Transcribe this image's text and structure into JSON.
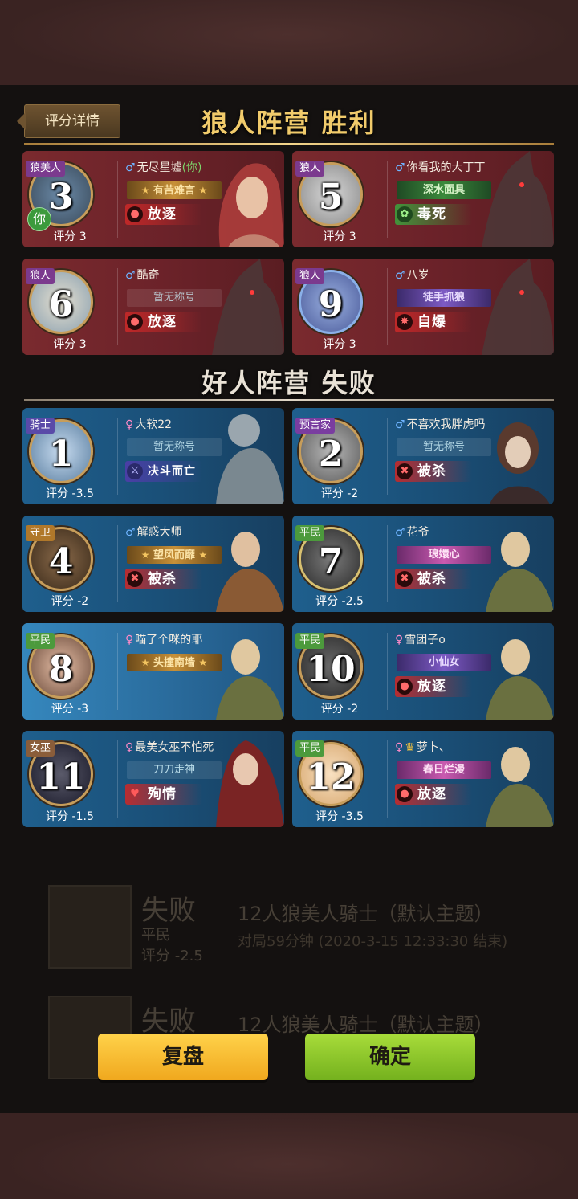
{
  "header": {
    "detail_button": "评分详情",
    "win_camp": "狼人阵营 胜利",
    "lose_camp": "好人阵营 失败"
  },
  "werewolf_cards": [
    {
      "seat": "3",
      "role": "狼美人",
      "gender": "♂",
      "name": "无尽星墟",
      "you_suffix": "(你)",
      "you_badge": "你",
      "title": "有苦难言",
      "outcome": "放逐",
      "score": "评分 3"
    },
    {
      "seat": "5",
      "role": "狼人",
      "gender": "♂",
      "name": "你看我的大丁丁",
      "title": "深水面具",
      "outcome": "毒死",
      "score": "评分 3"
    },
    {
      "seat": "6",
      "role": "狼人",
      "gender": "♂",
      "name": "酷奇",
      "title": "暂无称号",
      "outcome": "放逐",
      "score": "评分 3"
    },
    {
      "seat": "9",
      "role": "狼人",
      "gender": "♂",
      "name": "八岁",
      "title": "徒手抓狼",
      "outcome": "自爆",
      "score": "评分 3"
    }
  ],
  "villager_cards": [
    {
      "seat": "1",
      "role": "骑士",
      "gender": "♀",
      "name": "大软22",
      "title": "暂无称号",
      "outcome": "决斗而亡",
      "score": "评分 -3.5"
    },
    {
      "seat": "2",
      "role": "预言家",
      "gender": "♂",
      "name": "不喜欢我胖虎吗",
      "title": "暂无称号",
      "outcome": "被杀",
      "score": "评分 -2"
    },
    {
      "seat": "4",
      "role": "守卫",
      "gender": "♂",
      "name": "解惑大师",
      "title": "望风而靡",
      "outcome": "被杀",
      "score": "评分 -2"
    },
    {
      "seat": "7",
      "role": "平民",
      "gender": "♂",
      "name": "花爷",
      "title": "琅嬛心",
      "outcome": "被杀",
      "score": "评分 -2.5"
    },
    {
      "seat": "8",
      "role": "平民",
      "gender": "♀",
      "name": "喵了个咪的耶",
      "title": "头撞南墙",
      "outcome": "",
      "score": "评分 -3"
    },
    {
      "seat": "10",
      "role": "平民",
      "gender": "♀",
      "name": "雪团子o",
      "title": "小仙女",
      "outcome": "放逐",
      "score": "评分 -2"
    },
    {
      "seat": "11",
      "role": "女巫",
      "gender": "♀",
      "name": "最美女巫不怕死",
      "title": "刀刀走神",
      "outcome": "殉情",
      "score": "评分 -1.5"
    },
    {
      "seat": "12",
      "role": "平民",
      "gender": "♀",
      "name": "萝卜、",
      "title": "春日烂漫",
      "outcome": "放逐",
      "score": "评分 -3.5"
    }
  ],
  "background_list": [
    {
      "result": "失败",
      "role": "平民",
      "score": "评分 -2.5",
      "title": "12人狼美人骑士（默认主题）",
      "sub": "对局59分钟 (2020-3-15 12:33:30 结束)"
    },
    {
      "result": "失败",
      "title": "12人狼美人骑士（默认主题）"
    }
  ],
  "buttons": {
    "review": "复盘",
    "confirm": "确定"
  },
  "colors": {
    "wolf_card": "#6b2229",
    "good_card": "#1a4f77",
    "gold_title": "#f1cb6b",
    "review_btn": "#f0a81e",
    "confirm_btn": "#74b11e"
  }
}
